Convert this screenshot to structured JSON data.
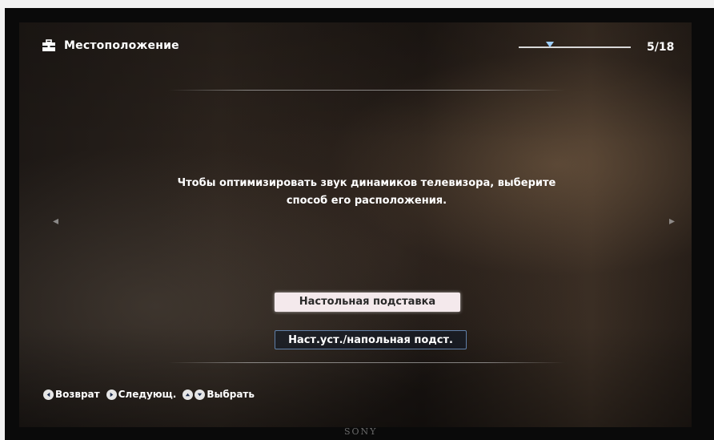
{
  "header": {
    "title": "Местоположение",
    "page_counter": "5/18"
  },
  "wizard_progress": {
    "current_step": 5,
    "total_steps": 18
  },
  "icons": {
    "title_icon": "toolbox-icon",
    "nav_left": "chevron-left-icon",
    "nav_right": "chevron-right-icon",
    "back": "circle-arrow-left-icon",
    "next": "circle-arrow-right-icon",
    "up": "circle-arrow-up-icon",
    "down": "circle-arrow-down-icon"
  },
  "message": {
    "line1": "Чтобы оптимизировать звук динамиков телевизора, выберите",
    "line2": "способ его расположения."
  },
  "options": [
    {
      "label": "Настольная подставка",
      "selected": true
    },
    {
      "label": "Наст.уст./напольная подст.",
      "selected": false
    }
  ],
  "footer": {
    "back_label": "Возврат",
    "next_label": "Следующ.",
    "select_label": "Выбрать"
  },
  "brand": "SONY",
  "colors": {
    "selected_option_bg": "#f4e9ec",
    "option_border": "#5f7fa8",
    "progress_marker": "#9fd0ff"
  }
}
